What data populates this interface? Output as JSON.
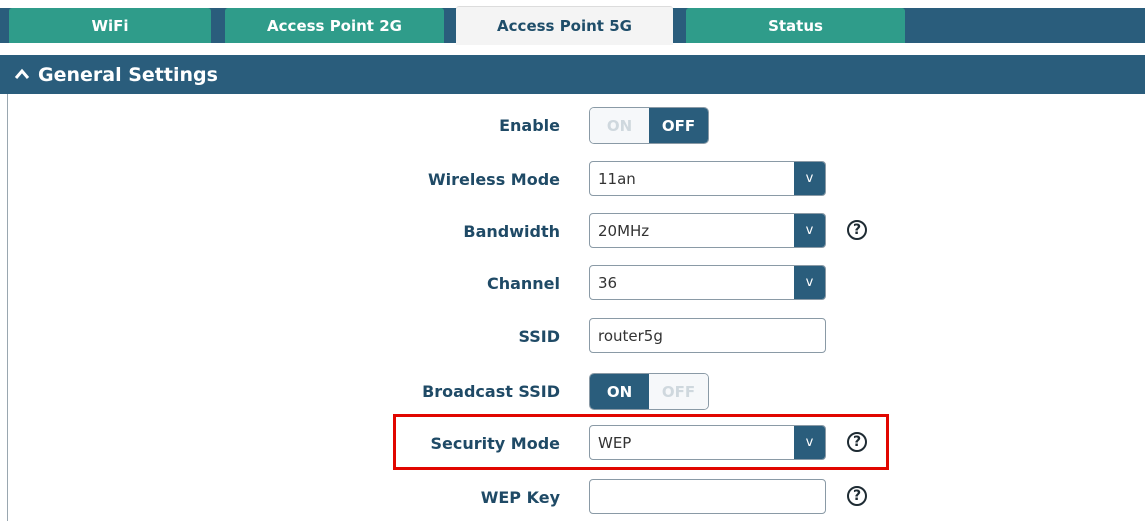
{
  "tabs": [
    {
      "label": "WiFi",
      "active": false
    },
    {
      "label": "Access Point 2G",
      "active": false
    },
    {
      "label": "Access Point 5G",
      "active": true
    },
    {
      "label": "Status",
      "active": false
    }
  ],
  "section": {
    "title": "General Settings",
    "icon": "caret-up-icon",
    "caret_glyph": "^"
  },
  "fields": {
    "enable": {
      "label": "Enable",
      "on_label": "ON",
      "off_label": "OFF",
      "state": "OFF"
    },
    "wireless_mode": {
      "label": "Wireless Mode",
      "value": "11an"
    },
    "bandwidth": {
      "label": "Bandwidth",
      "value": "20MHz"
    },
    "channel": {
      "label": "Channel",
      "value": "36"
    },
    "ssid": {
      "label": "SSID",
      "value": "router5g"
    },
    "broadcast_ssid": {
      "label": "Broadcast SSID",
      "on_label": "ON",
      "off_label": "OFF",
      "state": "ON"
    },
    "security_mode": {
      "label": "Security Mode",
      "value": "WEP"
    },
    "wep_key": {
      "label": "WEP Key",
      "value": ""
    }
  },
  "glyphs": {
    "dropdown": "v",
    "help": "?"
  },
  "colors": {
    "header": "#2a5d7c",
    "tab": "#2f9c8a",
    "highlight": "#e10600"
  }
}
